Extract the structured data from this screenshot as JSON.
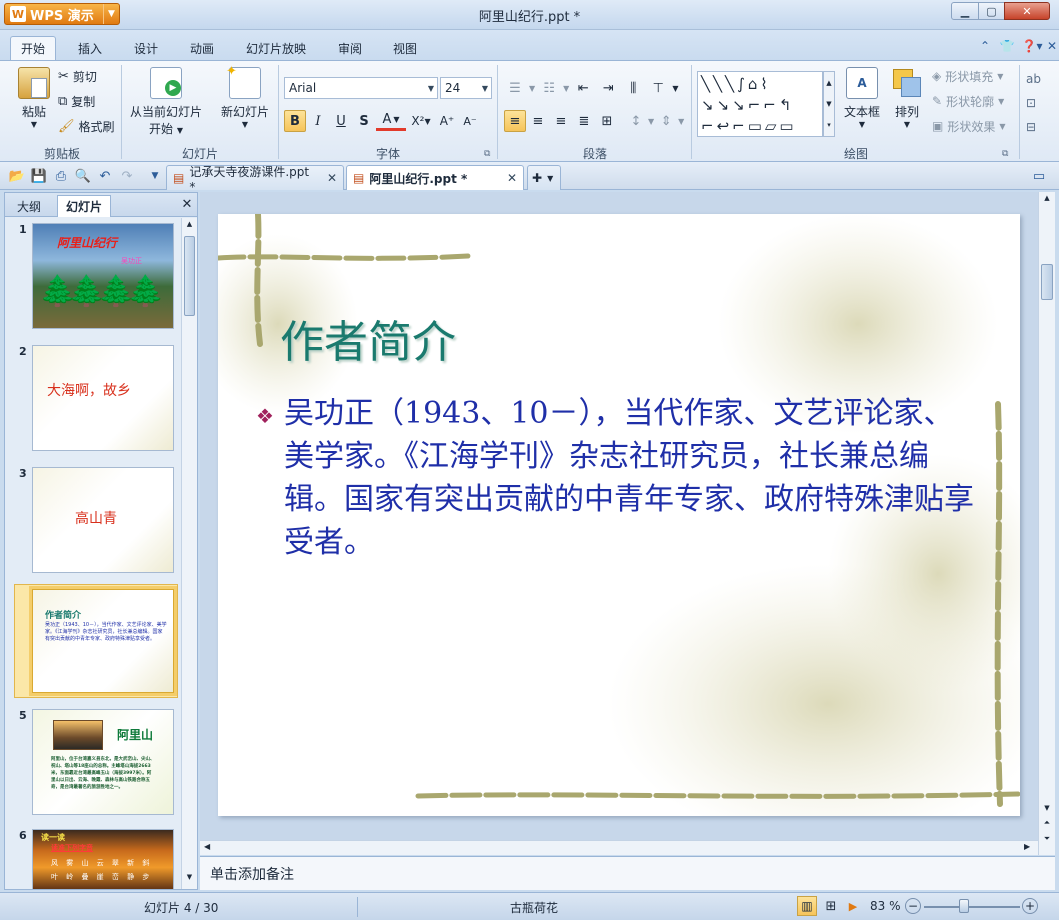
{
  "app": {
    "name": "WPS 演示",
    "window_title": "阿里山纪行.ppt *"
  },
  "ribbon_tabs": [
    "开始",
    "插入",
    "设计",
    "动画",
    "幻灯片放映",
    "审阅",
    "视图"
  ],
  "clipboard": {
    "paste": "粘贴",
    "cut": "剪切",
    "copy": "复制",
    "format_painter": "格式刷",
    "group": "剪贴板"
  },
  "slides_group": {
    "from_current_line1": "从当前幻灯片",
    "from_current_line2": "开始",
    "new_slide": "新幻灯片",
    "group": "幻灯片"
  },
  "font": {
    "family": "Arial",
    "size": "24",
    "group": "字体",
    "bold": "B",
    "italic": "I",
    "underline": "U",
    "shadow": "S",
    "color": "A",
    "superscript": "X²",
    "grow": "A⁺",
    "shrink": "A⁻"
  },
  "paragraph": {
    "group": "段落"
  },
  "drawing": {
    "textbox": "文本框",
    "arrange": "排列",
    "shape_fill": "形状填充",
    "shape_outline": "形状轮廓",
    "shape_effect": "形状效果",
    "group": "绘图"
  },
  "doc_tabs": [
    {
      "label": "记承天寺夜游课件.ppt *"
    },
    {
      "label": "阿里山纪行.ppt *"
    }
  ],
  "left_panel": {
    "tab_outline": "大纲",
    "tab_slides": "幻灯片"
  },
  "thumbnails": [
    {
      "num": "1",
      "title": "阿里山纪行",
      "sub": "吴功正"
    },
    {
      "num": "2",
      "title": "大海啊，故乡"
    },
    {
      "num": "3",
      "title": "高山青"
    },
    {
      "num": "4",
      "title": "作者简介",
      "body": "吴功正（1943、10－），当代作家、文艺评论家、美学家。《江海学刊》杂志社研究员，社长兼总编辑。国家有突出贡献的中青年专家、政府特殊津贴享受者。"
    },
    {
      "num": "5",
      "title": "阿里山",
      "body": "阿里山，位于台湾嘉义县东北，是大武峦山、尖山、祝山、塔山等18座山的总称。主峰塔山海拔2663米，东面靠近台湾最高峰玉山（海拔3997米）。阿里山以日出、云海、晚霞、森林与高山铁路合称五奇，是台湾最著名的旅游胜地之一。"
    },
    {
      "num": "6",
      "title": "读一读",
      "sub": "读准下列字音",
      "body": "风 雾 山 云 翠 新 斜 叶 岭 叠 崖 峦 静 步"
    }
  ],
  "slide": {
    "title": "作者简介",
    "bullet": "❖",
    "body": "吴功正（1943、10－），当代作家、文艺评论家、美学家。《江海学刊》杂志社研究员，社长兼总编辑。国家有突出贡献的中青年专家、政府特殊津贴享受者。"
  },
  "notes_placeholder": "单击添加备注",
  "status": {
    "slide_pos": "幻灯片 4 / 30",
    "template": "古瓶荷花",
    "zoom": "83 %"
  },
  "colors": {
    "slide_title": "#1a7a6e",
    "slide_body": "#1f2fa8",
    "bullet": "#a0215c",
    "accent_orange": "#e07a12"
  }
}
